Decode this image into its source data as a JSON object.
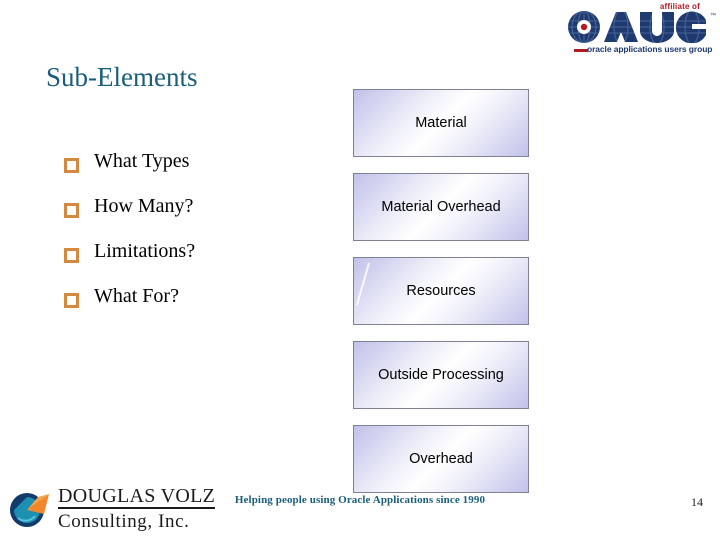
{
  "slide": {
    "title": "Sub-Elements",
    "page_number": "14"
  },
  "oaug_logo": {
    "affiliate_text": "affiliate of",
    "wordmark": "OAUG",
    "trademark": "™",
    "tagline": "oracle applications users group",
    "colors": {
      "navy": "#1f3a6e",
      "red": "#b01c23"
    }
  },
  "bullets": {
    "items": [
      {
        "label": "What Types"
      },
      {
        "label": "How Many?"
      },
      {
        "label": "Limitations?"
      },
      {
        "label": "What For?"
      }
    ],
    "marker_color": "#d4893f"
  },
  "flow_boxes": {
    "items": [
      {
        "label": "Material"
      },
      {
        "label": "Material Overhead"
      },
      {
        "label": "Resources"
      },
      {
        "label": "Outside Processing"
      },
      {
        "label": "Overhead"
      }
    ],
    "border_color": "#808094",
    "gradient_start": "#c2c2ea",
    "gradient_end": "#ffffff"
  },
  "footer": {
    "company_line1": "DOUGLAS VOLZ",
    "company_line2": "Consulting, Inc.",
    "tagline": "Helping people using Oracle Applications since 1990",
    "tagline_color": "#1a5e7a",
    "logo_colors": {
      "outer": "#123a6b",
      "inner": "#1d8fb0",
      "accent": "#f2862c"
    }
  }
}
